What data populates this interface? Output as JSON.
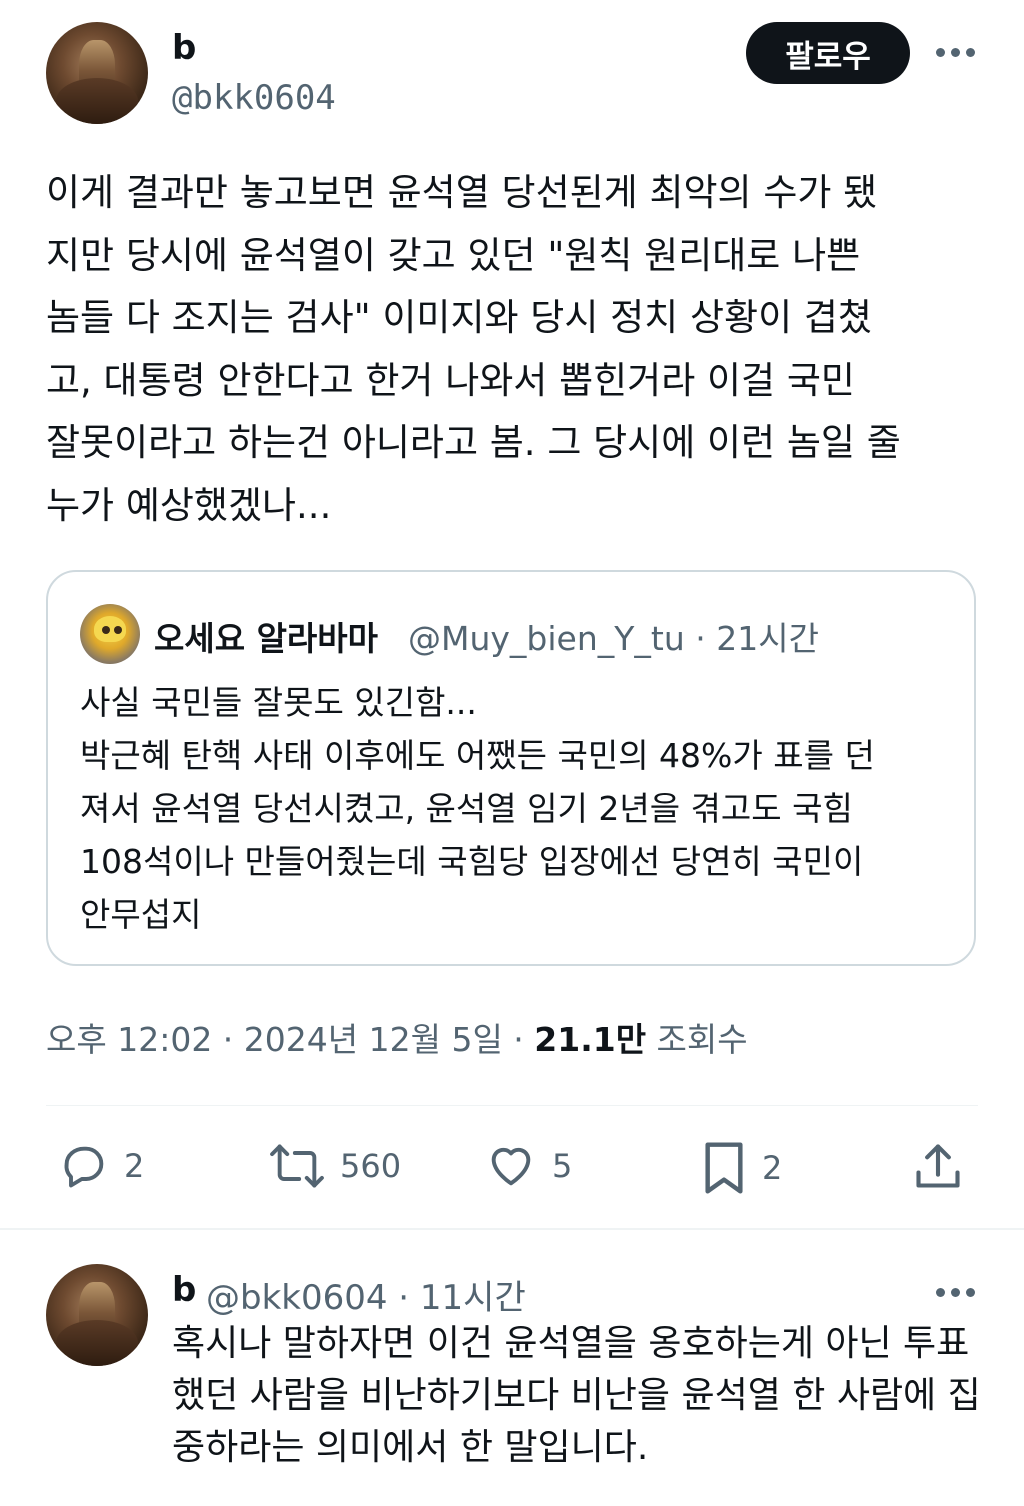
{
  "tweet": {
    "author_name": "b",
    "author_handle": "@bkk0604",
    "follow_label": "팔로우",
    "text": "이게 결과만 놓고보면 윤석열 당선된게 최악의 수가 됐\n지만 당시에 윤석열이 갖고 있던 \"원칙 원리대로 나쁜\n놈들 다 조지는 검사\" 이미지와 당시 정치 상황이 겹쳤\n고, 대통령 안한다고 한거 나와서 뽑힌거라 이걸 국민\n잘못이라고 하는건 아니라고 봄. 그 당시에 이런 놈일 줄\n누가 예상했겠나...",
    "timestamp": "오후 12:02 · 2024년 12월 5일 · ",
    "views_count": "21.1만",
    "views_label": " 조회수"
  },
  "quote": {
    "name": "오세요 알라바마",
    "handle_time": "@Muy_bien_Y_tu · 21시간",
    "text": "사실 국민들 잘못도 있긴함...\n박근혜 탄핵 사태 이후에도 어쨌든 국민의 48%가 표를 던\n져서 윤석열 당선시켰고, 윤석열 임기 2년을 겪고도 국힘\n108석이나 만들어줬는데 국힘당 입장에선 당연히 국민이\n안무섭지"
  },
  "actions": {
    "replies": "2",
    "retweets": "560",
    "likes": "5",
    "bookmarks": "2"
  },
  "reply": {
    "name": "b",
    "handle_time": "@bkk0604 · 11시간",
    "text": "혹시나 말하자면 이건 윤석열을 옹호하는게 아닌 투표\n했던 사람을 비난하기보다 비난을 윤석열 한 사람에 집\n중하라는 의미에서 한 말입니다."
  },
  "colors": {
    "text_primary": "#0f1419",
    "text_secondary": "#536471",
    "border": "#cfd9de",
    "divider": "#eff3f4"
  }
}
